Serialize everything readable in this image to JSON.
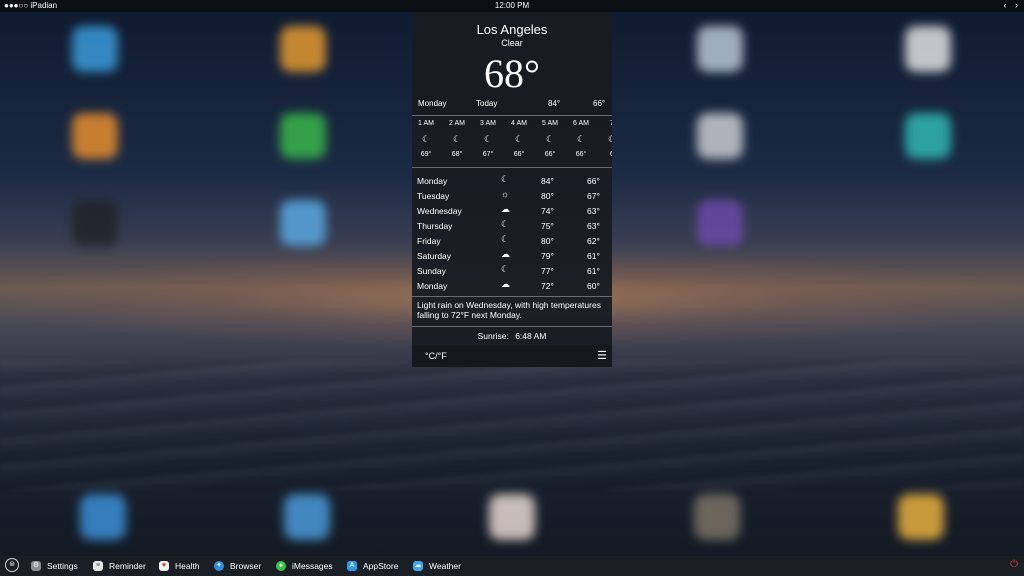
{
  "status_bar": {
    "carrier": "●●●○○ iPadian",
    "time": "12:00 PM",
    "back": "‹",
    "forward": "›"
  },
  "weather": {
    "city": "Los Angeles",
    "condition": "Clear",
    "temperature": "68°",
    "today": {
      "day": "Monday",
      "label": "Today",
      "high": "84°",
      "low": "66°"
    },
    "hourly": [
      {
        "time": "1 AM",
        "icon": "☾",
        "temp": "69°"
      },
      {
        "time": "2 AM",
        "icon": "☾",
        "temp": "68°"
      },
      {
        "time": "3 AM",
        "icon": "☾",
        "temp": "67°"
      },
      {
        "time": "4 AM",
        "icon": "☾",
        "temp": "66°"
      },
      {
        "time": "5 AM",
        "icon": "☾",
        "temp": "66°"
      },
      {
        "time": "6 AM",
        "icon": "☾",
        "temp": "66°"
      },
      {
        "time": "7",
        "icon": "☾",
        "temp": "6"
      }
    ],
    "daily": [
      {
        "day": "Monday",
        "icon": "☾",
        "high": "84°",
        "low": "66°"
      },
      {
        "day": "Tuesday",
        "icon": "☼",
        "high": "80°",
        "low": "67°"
      },
      {
        "day": "Wednesday",
        "icon": "☁",
        "high": "74°",
        "low": "63°"
      },
      {
        "day": "Thursday",
        "icon": "☾",
        "high": "75°",
        "low": "63°"
      },
      {
        "day": "Friday",
        "icon": "☾",
        "high": "80°",
        "low": "62°"
      },
      {
        "day": "Saturday",
        "icon": "☁",
        "high": "79°",
        "low": "61°"
      },
      {
        "day": "Sunday",
        "icon": "☾",
        "high": "77°",
        "low": "61°"
      },
      {
        "day": "Monday",
        "icon": "☁",
        "high": "72°",
        "low": "60°"
      }
    ],
    "forecast_text": "Light rain on Wednesday, with high temperatures falling to 72°F next Monday.",
    "sunrise_label": "Sunrise:",
    "sunrise_time": "6:48 AM",
    "units_toggle": "°C/°F",
    "menu_icon": "☰"
  },
  "dock": {
    "home_icon": "⊜",
    "items": [
      {
        "label": "Settings",
        "icon": "gear-icon",
        "color": "#8a8f96"
      },
      {
        "label": "Reminder",
        "icon": "list-icon",
        "color": "#e6e6e6"
      },
      {
        "label": "Health",
        "icon": "heart-icon",
        "color": "#f2f2f2"
      },
      {
        "label": "Browser",
        "icon": "compass-icon",
        "color": "#2f8de0"
      },
      {
        "label": "iMessages",
        "icon": "chat-icon",
        "color": "#35c44a"
      },
      {
        "label": "AppStore",
        "icon": "appstore-icon",
        "color": "#2a9bf0"
      },
      {
        "label": "Weather",
        "icon": "weather-icon",
        "color": "#3da9f0"
      }
    ],
    "power_icon": "⏻",
    "power_color": "#e0342a"
  }
}
